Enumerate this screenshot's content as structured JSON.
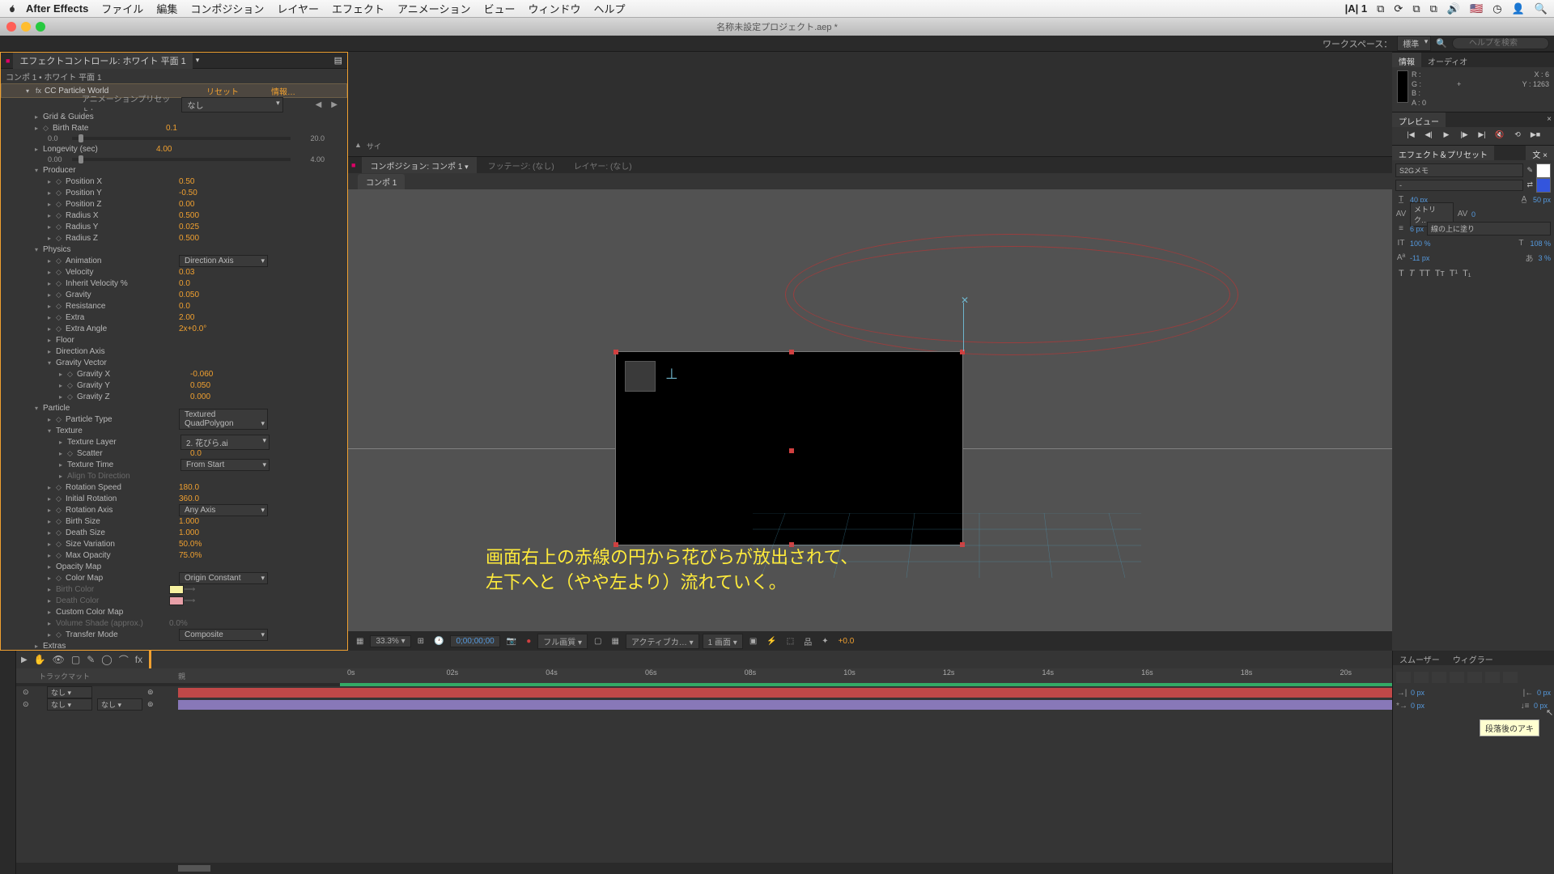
{
  "menubar": {
    "app": "After Effects",
    "items": [
      "ファイル",
      "編集",
      "コンポジション",
      "レイヤー",
      "エフェクト",
      "アニメーション",
      "ビュー",
      "ウィンドウ",
      "ヘルプ"
    ],
    "right_npass": "1"
  },
  "titlebar": {
    "title": "名称未設定プロジェクト.aep *"
  },
  "workspace": {
    "label": "ワークスペース：",
    "current": "標準",
    "help_placeholder": "ヘルプを検索"
  },
  "effectControls": {
    "tab": "エフェクトコントロール: ホワイト 平面 1",
    "path": "コンポ 1 • ホワイト 平面 1",
    "fx_name": "CC Particle World",
    "reset": "リセット",
    "about": "情報…",
    "preset_label": "アニメーションプリセット：",
    "preset_value": "なし",
    "props": [
      {
        "t": "group",
        "label": "Grid & Guides"
      },
      {
        "t": "param",
        "label": "Birth Rate",
        "val": "0.1",
        "kf": true,
        "slider": {
          "min": "0.0",
          "max": "20.0"
        }
      },
      {
        "t": "param",
        "label": "Longevity (sec)",
        "val": "4.00",
        "slider": {
          "min": "0.00",
          "max": "4.00"
        }
      },
      {
        "t": "group",
        "label": "Producer",
        "open": true
      },
      {
        "t": "param",
        "sub": 1,
        "label": "Position X",
        "val": "0.50",
        "kf": true
      },
      {
        "t": "param",
        "sub": 1,
        "label": "Position Y",
        "val": "-0.50",
        "kf": true
      },
      {
        "t": "param",
        "sub": 1,
        "label": "Position Z",
        "val": "0.00",
        "kf": true
      },
      {
        "t": "param",
        "sub": 1,
        "label": "Radius X",
        "val": "0.500",
        "kf": true
      },
      {
        "t": "param",
        "sub": 1,
        "label": "Radius Y",
        "val": "0.025",
        "kf": true
      },
      {
        "t": "param",
        "sub": 1,
        "label": "Radius Z",
        "val": "0.500",
        "kf": true
      },
      {
        "t": "group",
        "label": "Physics",
        "open": true
      },
      {
        "t": "dropdown",
        "sub": 1,
        "label": "Animation",
        "val": "Direction Axis",
        "kf": true
      },
      {
        "t": "param",
        "sub": 1,
        "label": "Velocity",
        "val": "0.03",
        "kf": true
      },
      {
        "t": "param",
        "sub": 1,
        "label": "Inherit Velocity %",
        "val": "0.0",
        "kf": true
      },
      {
        "t": "param",
        "sub": 1,
        "label": "Gravity",
        "val": "0.050",
        "kf": true
      },
      {
        "t": "param",
        "sub": 1,
        "label": "Resistance",
        "val": "0.0",
        "kf": true
      },
      {
        "t": "param",
        "sub": 1,
        "label": "Extra",
        "val": "2.00",
        "kf": true
      },
      {
        "t": "param",
        "sub": 1,
        "label": "Extra Angle",
        "val": "2x+0.0°",
        "kf": true
      },
      {
        "t": "group",
        "sub": 1,
        "label": "Floor"
      },
      {
        "t": "group",
        "sub": 1,
        "label": "Direction Axis"
      },
      {
        "t": "group",
        "sub": 1,
        "label": "Gravity Vector",
        "open": true
      },
      {
        "t": "param",
        "sub": 2,
        "label": "Gravity X",
        "val": "-0.060",
        "kf": true
      },
      {
        "t": "param",
        "sub": 2,
        "label": "Gravity Y",
        "val": "0.050",
        "kf": true
      },
      {
        "t": "param",
        "sub": 2,
        "label": "Gravity Z",
        "val": "0.000",
        "kf": true
      },
      {
        "t": "group",
        "label": "Particle",
        "open": true
      },
      {
        "t": "dropdown",
        "sub": 1,
        "label": "Particle Type",
        "val": "Textured QuadPolygon",
        "kf": true
      },
      {
        "t": "group",
        "sub": 1,
        "label": "Texture",
        "open": true
      },
      {
        "t": "dropdown",
        "sub": 2,
        "label": "Texture Layer",
        "val": "2. 花びら.ai"
      },
      {
        "t": "param",
        "sub": 2,
        "label": "Scatter",
        "val": "0.0",
        "kf": true
      },
      {
        "t": "dropdown",
        "sub": 2,
        "label": "Texture Time",
        "val": "From Start"
      },
      {
        "t": "static",
        "sub": 2,
        "label": "Align To Direction",
        "dim": true
      },
      {
        "t": "param",
        "sub": 1,
        "label": "Rotation Speed",
        "val": "180.0",
        "kf": true
      },
      {
        "t": "param",
        "sub": 1,
        "label": "Initial Rotation",
        "val": "360.0",
        "kf": true
      },
      {
        "t": "dropdown",
        "sub": 1,
        "label": "Rotation Axis",
        "val": "Any Axis",
        "kf": true
      },
      {
        "t": "param",
        "sub": 1,
        "label": "Birth Size",
        "val": "1.000",
        "kf": true
      },
      {
        "t": "param",
        "sub": 1,
        "label": "Death Size",
        "val": "1.000",
        "kf": true
      },
      {
        "t": "param",
        "sub": 1,
        "label": "Size Variation",
        "val": "50.0%",
        "kf": true
      },
      {
        "t": "param",
        "sub": 1,
        "label": "Max Opacity",
        "val": "75.0%",
        "kf": true
      },
      {
        "t": "group",
        "sub": 1,
        "label": "Opacity Map"
      },
      {
        "t": "dropdown",
        "sub": 1,
        "label": "Color Map",
        "val": "Origin Constant",
        "kf": true
      },
      {
        "t": "color",
        "sub": 1,
        "label": "Birth Color",
        "color": "#f7f2a0",
        "dim": true
      },
      {
        "t": "color",
        "sub": 1,
        "label": "Death Color",
        "color": "#e8a0a8",
        "dim": true
      },
      {
        "t": "group",
        "sub": 1,
        "label": "Custom Color Map"
      },
      {
        "t": "param",
        "sub": 1,
        "label": "Volume Shade (approx.)",
        "val": "0.0%",
        "dim": true
      },
      {
        "t": "dropdown",
        "sub": 1,
        "label": "Transfer Mode",
        "val": "Composite",
        "kf": true
      },
      {
        "t": "group",
        "label": "Extras"
      }
    ]
  },
  "compPanel": {
    "tabs": [
      {
        "label": "コンポジション: コンポ 1",
        "active": true
      },
      {
        "label": "フッテージ: (なし)",
        "active": false
      },
      {
        "label": "レイヤー: (なし)",
        "active": false
      }
    ],
    "flow": "コンポ 1",
    "annotation_l1": "画面右上の赤線の円から花びらが放出されて、",
    "annotation_l2": "左下へと（やや左より）流れていく。",
    "footer": {
      "zoom": "33.3%",
      "time": "0;00;00;00",
      "quality": "フル画質",
      "activecam": "アクティブカ…",
      "views": "1 画面",
      "exposure": "+0.0"
    }
  },
  "rightPanels": {
    "info": {
      "tabs": [
        "情報",
        "オーディオ"
      ],
      "R": "R :",
      "G": "G :",
      "B": "B :",
      "A": "A : 0",
      "X": "X : 6",
      "Y": "Y : 1263"
    },
    "preview": {
      "tab": "プレビュー"
    },
    "fxpreset": {
      "tab": "エフェクト＆プリセット"
    },
    "char": {
      "tab": "文字",
      "font": "S2Gメモ",
      "size": "40 px",
      "leading": "50 px",
      "metrics": "メトリク…",
      "metrics_val": "0",
      "stroke_w": "6 px",
      "stroke_pos": "線の上に塗り",
      "vscale": "100 %",
      "hscale": "108 %",
      "baseline": "-11 px",
      "tsume": "3 %"
    }
  },
  "timeline": {
    "header_col": "トラックマット",
    "ticks": [
      "0s",
      "02s",
      "04s",
      "06s",
      "08s",
      "10s",
      "12s",
      "14s",
      "16s",
      "18s",
      "20s"
    ],
    "layers": [
      {
        "mode": "なし",
        "track": "なし",
        "color": "red"
      },
      {
        "mode": "なし",
        "track": "なし",
        "color": "purple"
      }
    ]
  },
  "paraPanel": {
    "tabs": [
      "スムーザー",
      "ウィグラー"
    ],
    "indent_l": "0 px",
    "indent_r": "0 px",
    "first_line": "0 px",
    "after": "0 px",
    "tooltip": "段落後のアキ"
  },
  "colors": {
    "accent": "#f0a030",
    "link": "#5599dd"
  }
}
